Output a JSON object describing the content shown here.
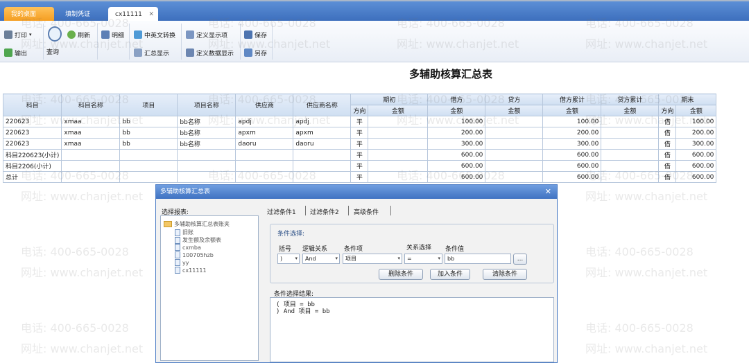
{
  "tabs": [
    "我的桌面",
    "填制凭证",
    "cx11111"
  ],
  "toolbar": {
    "print": "打印",
    "output": "输出",
    "query": "查询",
    "refresh": "刷新",
    "detail": "明细",
    "cn_en_switch": "中英文转换",
    "summary_display": "汇总显示",
    "define_display": "定义显示项",
    "define_data_display": "定义数据显示",
    "save": "保存",
    "save_as": "另存"
  },
  "report_title": "多辅助核算汇总表",
  "table": {
    "header_top": [
      "科目",
      "科目名称",
      "项目",
      "项目名称",
      "供应商",
      "供应商名称",
      "期初",
      "借方",
      "贷方",
      "借方累计",
      "贷方累计",
      "期末"
    ],
    "header_sub": [
      "方向",
      "金额",
      "金额",
      "金额",
      "金额",
      "金额",
      "方向",
      "金额"
    ],
    "rows": [
      [
        "220623",
        "xmaa",
        "bb",
        "bb名称",
        "apdj",
        "apdj",
        "平",
        "",
        "100.00",
        "",
        "100.00",
        "",
        "借",
        "100.00"
      ],
      [
        "220623",
        "xmaa",
        "bb",
        "bb名称",
        "apxm",
        "apxm",
        "平",
        "",
        "200.00",
        "",
        "200.00",
        "",
        "借",
        "200.00"
      ],
      [
        "220623",
        "xmaa",
        "bb",
        "bb名称",
        "daoru",
        "daoru",
        "平",
        "",
        "300.00",
        "",
        "300.00",
        "",
        "借",
        "300.00"
      ],
      [
        "科目220623(小计)",
        "",
        "",
        "",
        "",
        "",
        "平",
        "",
        "600.00",
        "",
        "600.00",
        "",
        "借",
        "600.00"
      ],
      [
        "科目2206(小计)",
        "",
        "",
        "",
        "",
        "",
        "平",
        "",
        "600.00",
        "",
        "600.00",
        "",
        "借",
        "600.00"
      ],
      [
        "总计",
        "",
        "",
        "",
        "",
        "",
        "平",
        "",
        "600.00",
        "",
        "600.00",
        "",
        "借",
        "600.00"
      ]
    ]
  },
  "watermark": {
    "phone": "电话: 400-665-0028",
    "site": "网址: www.chanjet.net"
  },
  "dialog": {
    "title": "多辅助核算汇总表",
    "select_report_label": "选择报表:",
    "tree_root": "多辅助核算汇总表账夹",
    "tree_items": [
      "旧账",
      "发生额及余额表",
      "cxmba",
      "100705hzb",
      "yy",
      "cx11111"
    ],
    "tabs": [
      "过滤条件1",
      "过滤条件2",
      "高级条件"
    ],
    "condition_group_label": "条件选择:",
    "col_labels": {
      "bracket": "括号",
      "logic": "逻辑关系",
      "item": "条件项",
      "relation": "关系选择",
      "value": "条件值"
    },
    "values": {
      "bracket": ")",
      "logic": "And",
      "item": "项目",
      "relation": "=",
      "value": "bb"
    },
    "more_button": "...",
    "buttons": {
      "delete": "删除条件",
      "add": "加入条件",
      "clear": "清除条件"
    },
    "result_label": "条件选择结果:",
    "result_lines": [
      "(    项目 = bb",
      ") And 项目 = bb"
    ]
  }
}
